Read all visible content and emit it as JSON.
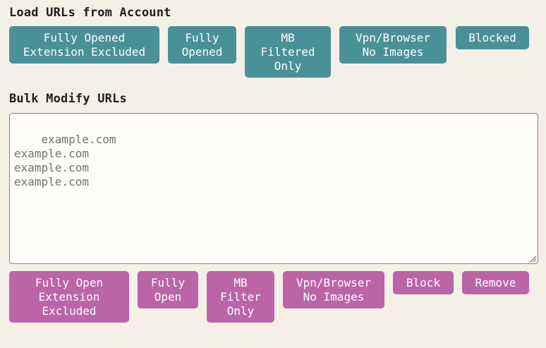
{
  "load_section": {
    "title": "Load URLs from Account",
    "buttons": [
      {
        "label": "Fully Opened\nExtension Excluded"
      },
      {
        "label": "Fully\nOpened"
      },
      {
        "label": "MB\nFiltered\nOnly"
      },
      {
        "label": "Vpn/Browser\nNo Images"
      },
      {
        "label": "Blocked"
      }
    ]
  },
  "bulk_section": {
    "title": "Bulk Modify URLs",
    "textarea_value": "example.com\nexample.com\nexample.com\nexample.com",
    "buttons": [
      {
        "label": "Fully Open\nExtension\nExcluded"
      },
      {
        "label": "Fully\nOpen"
      },
      {
        "label": "MB\nFilter\nOnly"
      },
      {
        "label": "Vpn/Browser\nNo Images"
      },
      {
        "label": "Block"
      },
      {
        "label": "Remove"
      }
    ]
  },
  "colors": {
    "background": "#f4f0e7",
    "load_button": "#4a9097",
    "modify_button": "#bb64a8",
    "textarea_border": "#a86ea1"
  }
}
